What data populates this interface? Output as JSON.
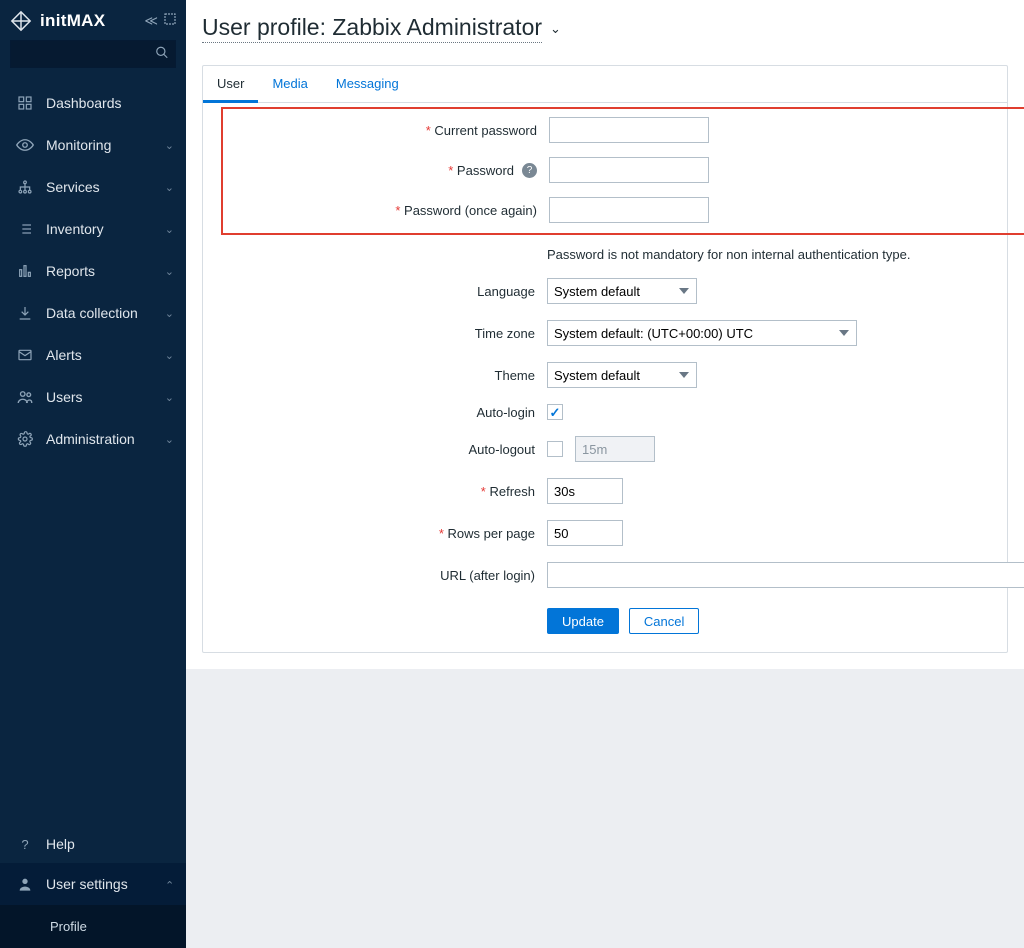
{
  "brand": "initMAX",
  "search": {
    "placeholder": ""
  },
  "sidebar": {
    "items": [
      {
        "label": "Dashboards",
        "icon": "dashboard-icon",
        "expandable": false
      },
      {
        "label": "Monitoring",
        "icon": "eye-icon",
        "expandable": true
      },
      {
        "label": "Services",
        "icon": "hierarchy-icon",
        "expandable": true
      },
      {
        "label": "Inventory",
        "icon": "list-icon",
        "expandable": true
      },
      {
        "label": "Reports",
        "icon": "bar-chart-icon",
        "expandable": true
      },
      {
        "label": "Data collection",
        "icon": "download-icon",
        "expandable": true
      },
      {
        "label": "Alerts",
        "icon": "mail-icon",
        "expandable": true
      },
      {
        "label": "Users",
        "icon": "users-icon",
        "expandable": true
      },
      {
        "label": "Administration",
        "icon": "gear-icon",
        "expandable": true
      }
    ],
    "bottom": {
      "help": "Help",
      "user_settings": "User settings",
      "profile": "Profile"
    }
  },
  "page_title": "User profile: Zabbix Administrator",
  "tabs": {
    "user": "User",
    "media": "Media",
    "messaging": "Messaging"
  },
  "form": {
    "labels": {
      "current_password": "Current password",
      "password": "Password",
      "password_again": "Password (once again)",
      "language": "Language",
      "time_zone": "Time zone",
      "theme": "Theme",
      "auto_login": "Auto-login",
      "auto_logout": "Auto-logout",
      "refresh": "Refresh",
      "rows_per_page": "Rows per page",
      "url_after_login": "URL (after login)"
    },
    "values": {
      "current_password": "",
      "password": "",
      "password_again": "",
      "language": "System default",
      "time_zone": "System default: (UTC+00:00) UTC",
      "theme": "System default",
      "auto_login": true,
      "auto_logout": false,
      "auto_logout_value": "15m",
      "refresh": "30s",
      "rows_per_page": "50",
      "url_after_login": ""
    },
    "note": "Password is not mandatory for non internal authentication type."
  },
  "buttons": {
    "update": "Update",
    "cancel": "Cancel"
  }
}
